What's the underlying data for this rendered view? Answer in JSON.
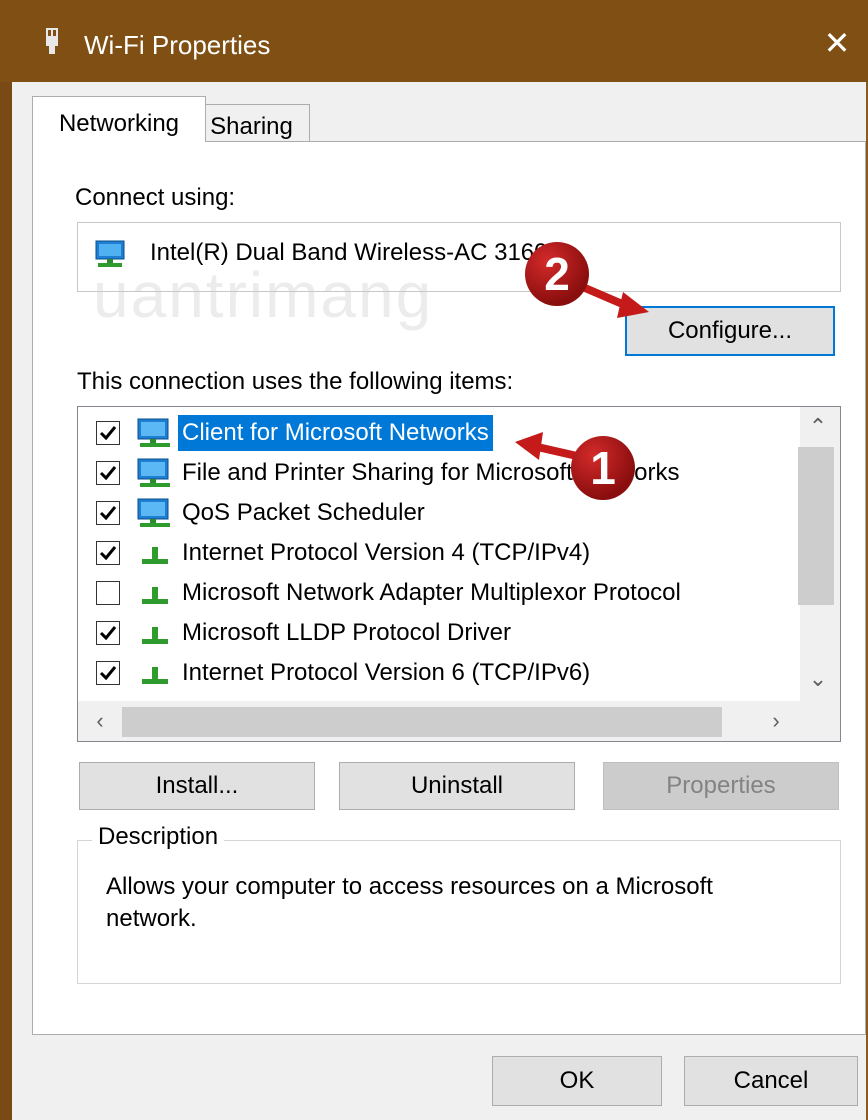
{
  "window": {
    "title": "Wi-Fi Properties",
    "close_label": "✕"
  },
  "tabs": [
    {
      "label": "Networking",
      "active": true
    },
    {
      "label": "Sharing",
      "active": false
    }
  ],
  "connect_using": {
    "label": "Connect using:",
    "adapter_name": "Intel(R) Dual Band Wireless-AC 3160",
    "configure_label": "Configure..."
  },
  "items_section": {
    "label": "This connection uses the following items:",
    "items": [
      {
        "label": "Client for Microsoft Networks",
        "checked": true,
        "selected": true,
        "icon": "network-computer-icon"
      },
      {
        "label": "File and Printer Sharing for Microsoft Networks",
        "checked": true,
        "selected": false,
        "icon": "network-computer-icon"
      },
      {
        "label": "QoS Packet Scheduler",
        "checked": true,
        "selected": false,
        "icon": "network-computer-icon"
      },
      {
        "label": "Internet Protocol Version 4 (TCP/IPv4)",
        "checked": true,
        "selected": false,
        "icon": "protocol-icon"
      },
      {
        "label": "Microsoft Network Adapter Multiplexor Protocol",
        "checked": false,
        "selected": false,
        "icon": "protocol-icon"
      },
      {
        "label": "Microsoft LLDP Protocol Driver",
        "checked": true,
        "selected": false,
        "icon": "protocol-icon"
      },
      {
        "label": "Internet Protocol Version 6 (TCP/IPv6)",
        "checked": true,
        "selected": false,
        "icon": "protocol-icon"
      }
    ]
  },
  "buttons": {
    "install": "Install...",
    "uninstall": "Uninstall",
    "properties": "Properties",
    "ok": "OK",
    "cancel": "Cancel"
  },
  "description": {
    "legend": "Description",
    "text": "Allows your computer to access resources on a Microsoft network."
  },
  "callouts": {
    "one": "1",
    "two": "2"
  },
  "watermark": "uantrimang",
  "colors": {
    "titlebar": "#7f4f14",
    "selection": "#0078d7",
    "callout": "#b01818"
  }
}
